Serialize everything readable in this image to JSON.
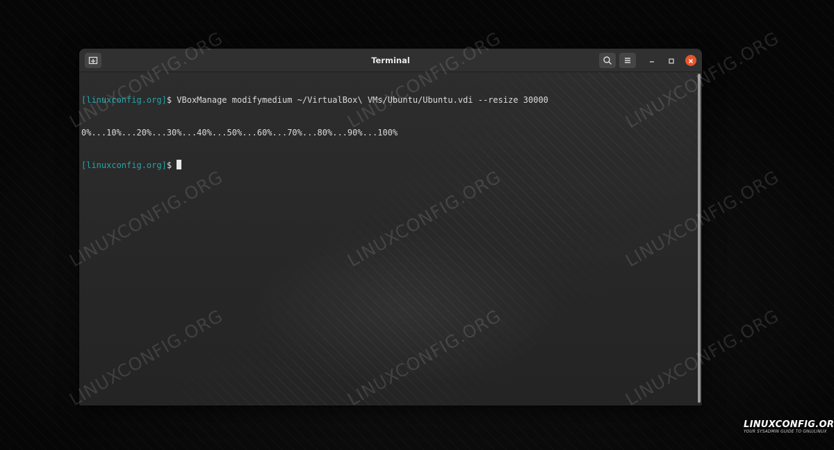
{
  "window": {
    "title": "Terminal"
  },
  "terminal": {
    "prompt": "[linuxconfig.org]",
    "lines": [
      {
        "prompt": "[linuxconfig.org]",
        "text": "$ VBoxManage modifymedium ~/VirtualBox\\ VMs/Ubuntu/Ubuntu.vdi --resize 30000"
      },
      {
        "prompt": "",
        "text": "0%...10%...20%...30%...40%...50%...60%...70%...80%...90%...100%"
      },
      {
        "prompt": "[linuxconfig.org]",
        "text": "$ "
      }
    ]
  },
  "toolbar": {
    "new_tab_icon": "new-tab-icon",
    "search_icon": "search-icon",
    "menu_icon": "hamburger-menu-icon",
    "minimize_icon": "minimize-icon",
    "maximize_icon": "maximize-icon",
    "close_icon": "close-icon"
  },
  "watermark": {
    "text": "LINUXCONFIG.ORG"
  },
  "logo": {
    "main": "LINUXCONFIG.ORG",
    "tagline": "YOUR SYSADMIN GUIDE TO GNU/LINUX"
  },
  "colors": {
    "prompt": "#27a3a8",
    "close_button": "#e9542b",
    "terminal_bg": "#2c2c2c"
  }
}
